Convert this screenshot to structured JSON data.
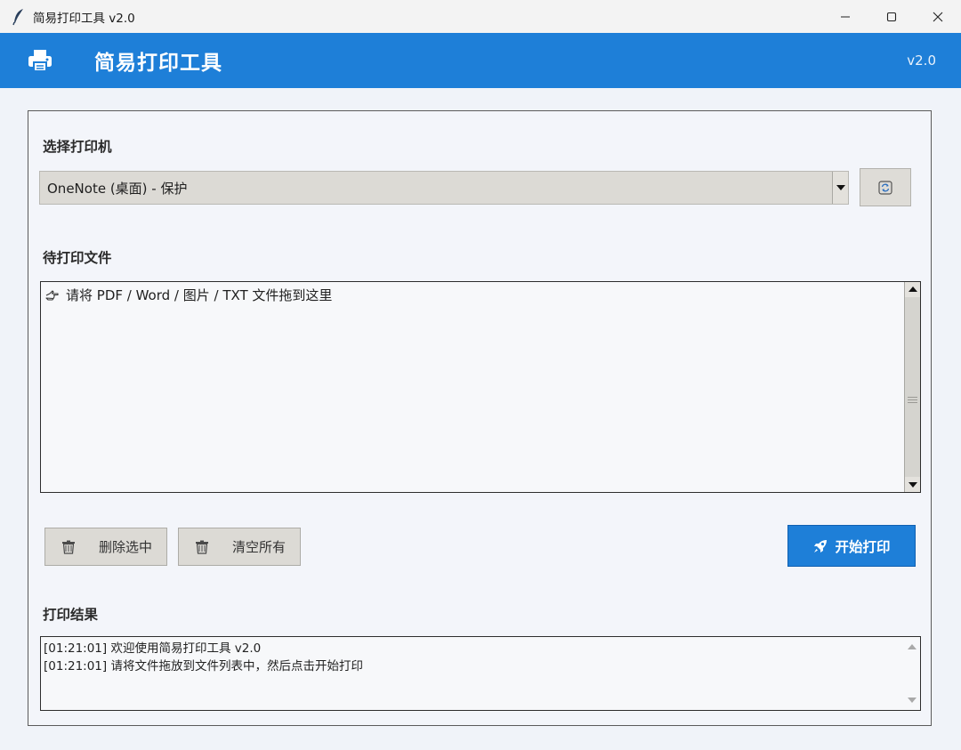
{
  "window": {
    "title": "简易打印工具 v2.0",
    "controls": [
      "minimize",
      "maximize",
      "close"
    ]
  },
  "header": {
    "title": "简易打印工具",
    "version": "v2.0",
    "icon": "printer-icon",
    "background": "#1e7fd8"
  },
  "printer": {
    "label": "选择打印机",
    "selected": "OneNote (桌面) - 保护",
    "refresh_icon": "refresh-icon"
  },
  "files": {
    "label": "待打印文件",
    "placeholder": "请将 PDF / Word / 图片 / TXT 文件拖到这里",
    "placeholder_icon": "pointing-hand-icon"
  },
  "actions": {
    "delete_selected": "删除选中",
    "clear_all": "清空所有",
    "start_print": "开始打印"
  },
  "result": {
    "label": "打印结果",
    "lines": [
      "[01:21:01] 欢迎使用简易打印工具 v2.0",
      "[01:21:01] 请将文件拖放到文件列表中，然后点击开始打印"
    ]
  }
}
